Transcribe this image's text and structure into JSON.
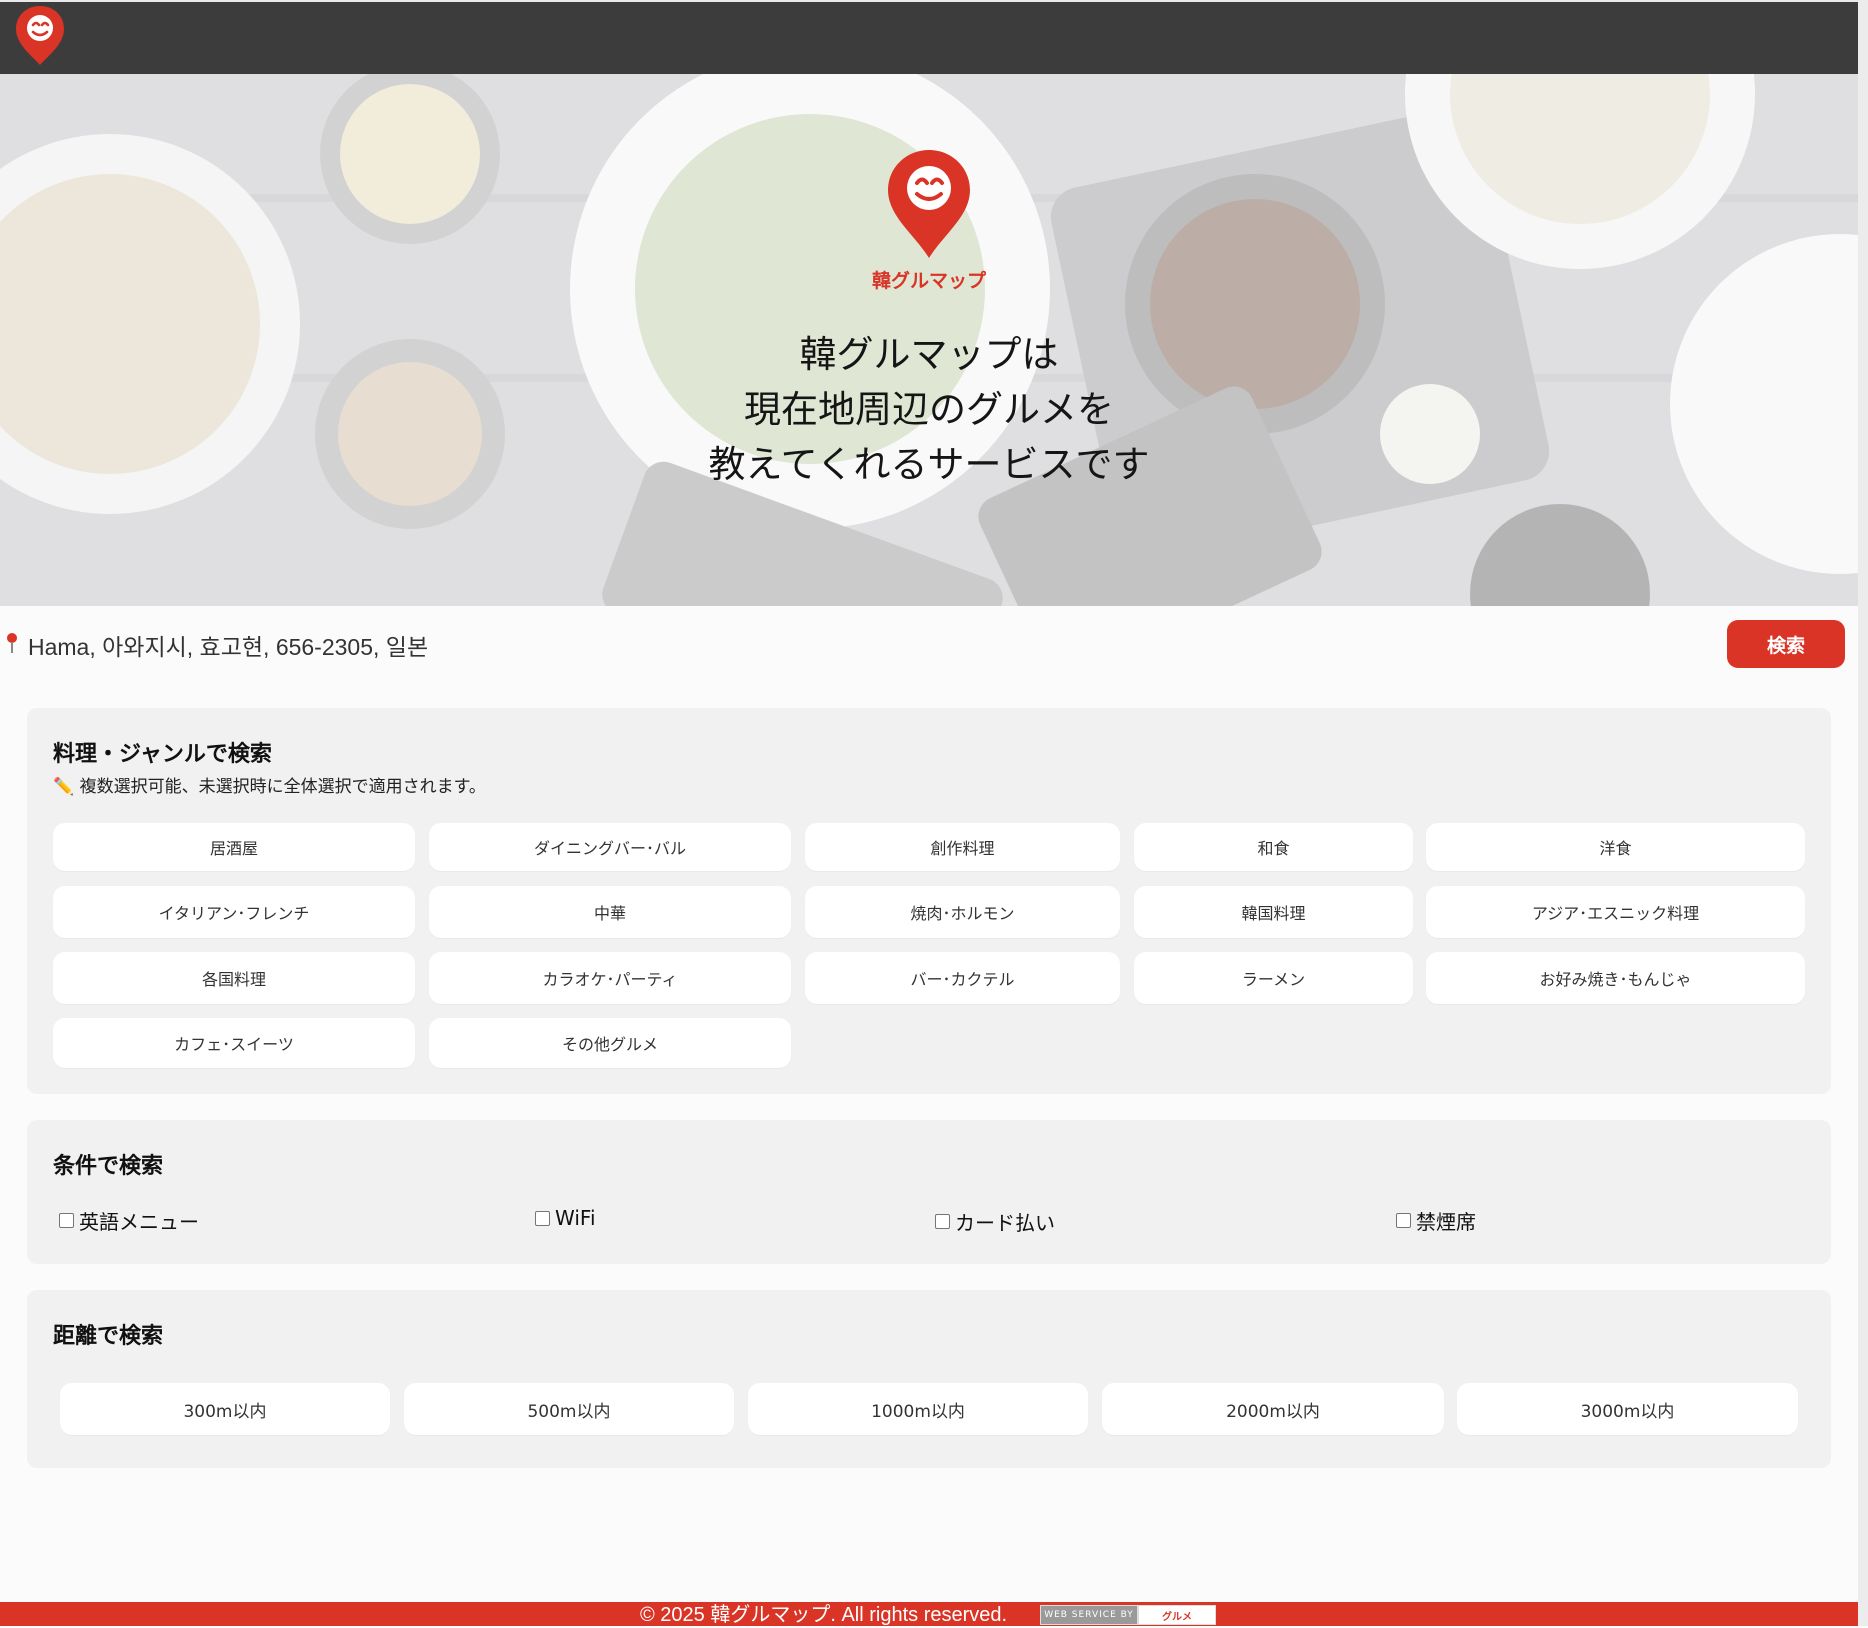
{
  "header": {
    "logo_icon": "gourmet-map-pin-icon"
  },
  "hero": {
    "brand_name": "韓グルマップ",
    "tagline": [
      "韓グルマップは",
      "現在地周辺のグルメを",
      "教えてくれるサービスです"
    ]
  },
  "location": {
    "pin_icon": "location-pin-icon",
    "address": "Hama, 아와지시, 효고현, 656-2305, 일본"
  },
  "search_button_label": "検索",
  "genre": {
    "title": "料理・ジャンルで検索",
    "note_icon": "pencil-icon",
    "note": "複数選択可能、未選択時に全体選択で適用されます。",
    "options": [
      "居酒屋",
      "ダイニングバー･バル",
      "創作料理",
      "和食",
      "洋食",
      "イタリアン･フレンチ",
      "中華",
      "焼肉･ホルモン",
      "韓国料理",
      "アジア･エスニック料理",
      "各国料理",
      "カラオケ･パーティ",
      "バー･カクテル",
      "ラーメン",
      "お好み焼き･もんじゃ",
      "カフェ･スイーツ",
      "その他グルメ"
    ]
  },
  "conditions": {
    "title": "条件で検索",
    "options": [
      "英語メニュー",
      "WiFi",
      "カード払い",
      "禁煙席"
    ]
  },
  "distance": {
    "title": "距離で検索",
    "options": [
      "300m以内",
      "500m以内",
      "1000m以内",
      "2000m以内",
      "3000m以内"
    ]
  },
  "footer": {
    "copyright": "© 2025 韓グルマップ. All rights reserved.",
    "badge_left": "WEB SERVICE BY",
    "badge_right": "グルメ"
  },
  "colors": {
    "brand_red": "#d93425",
    "topbar": "#3c3c3c",
    "panel_bg": "#f1f1f1"
  }
}
